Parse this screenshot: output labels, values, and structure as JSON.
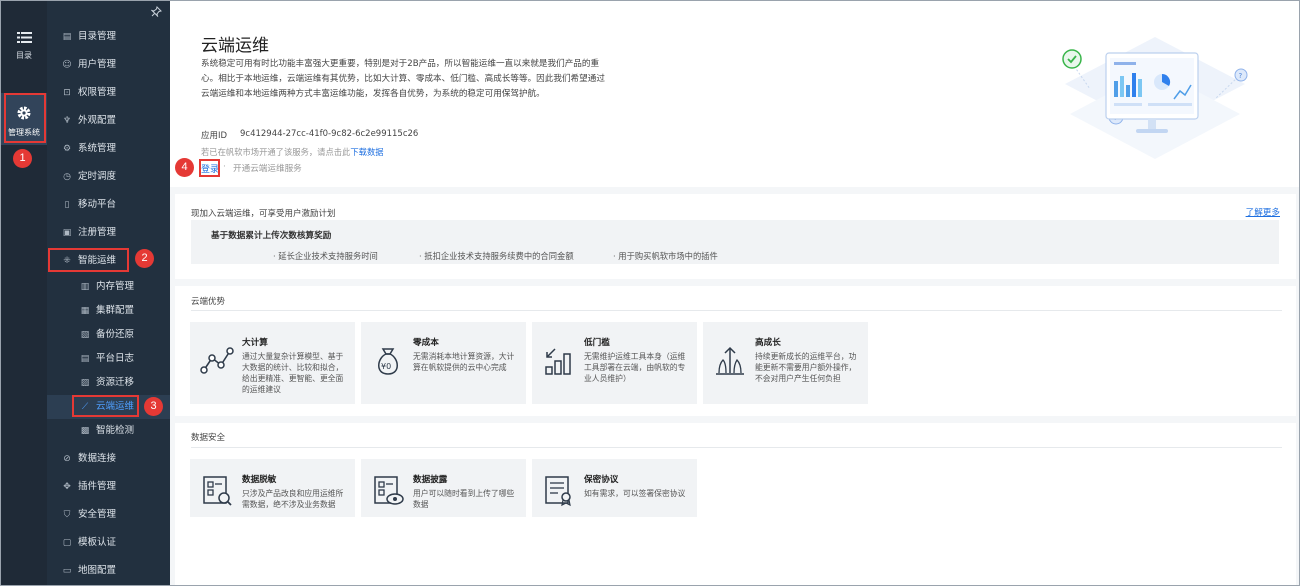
{
  "rail": {
    "items": [
      {
        "label": "目录",
        "icon": "list-icon"
      },
      {
        "label": "管理系统",
        "icon": "gear-icon"
      }
    ]
  },
  "nav": {
    "items": [
      {
        "label": "目录管理",
        "icon": "folder-icon"
      },
      {
        "label": "用户管理",
        "icon": "user-icon"
      },
      {
        "label": "权限管理",
        "icon": "lock-icon"
      },
      {
        "label": "外观配置",
        "icon": "paint-icon"
      },
      {
        "label": "系统管理",
        "icon": "settings-icon"
      },
      {
        "label": "定时调度",
        "icon": "clock-icon"
      },
      {
        "label": "移动平台",
        "icon": "mobile-icon"
      },
      {
        "label": "注册管理",
        "icon": "register-icon"
      },
      {
        "label": "智能运维",
        "icon": "nodes-icon"
      }
    ],
    "sub_items": [
      {
        "label": "内存管理",
        "icon": "memory-icon"
      },
      {
        "label": "集群配置",
        "icon": "cluster-icon"
      },
      {
        "label": "备份还原",
        "icon": "backup-icon"
      },
      {
        "label": "平台日志",
        "icon": "log-icon"
      },
      {
        "label": "资源迁移",
        "icon": "migrate-icon"
      },
      {
        "label": "云端运维",
        "icon": "chart-line-icon"
      },
      {
        "label": "智能检测",
        "icon": "detect-icon"
      }
    ],
    "bottom_items": [
      {
        "label": "数据连接",
        "icon": "link-icon"
      },
      {
        "label": "插件管理",
        "icon": "plugin-icon"
      },
      {
        "label": "安全管理",
        "icon": "shield-icon"
      },
      {
        "label": "模板认证",
        "icon": "certificate-icon"
      },
      {
        "label": "地图配置",
        "icon": "map-icon"
      }
    ]
  },
  "badges": [
    "1",
    "2",
    "3",
    "4"
  ],
  "hero": {
    "title": "云端运维",
    "description": "系统稳定可用有时比功能丰富强大更重要，特别是对于2B产品，所以智能运维一直以来就是我们产品的重心。相比于本地运维，云端运维有其优势，比如大计算、零成本、低门槛、高成长等等。因此我们希望通过云端运维和本地运维两种方式丰富运维功能，发挥各自优势，为系统的稳定可用保驾护航。",
    "app_id_label": "应用ID",
    "app_id": "9c412944-27cc-41f0-9c82-6c2e99115c26",
    "hint_prefix": "若已在帆软市场开通了该服务，请点击此",
    "hint_link": "下载数据",
    "login": "登录",
    "separator": "·",
    "open_service": "开通云端运维服务"
  },
  "incentive": {
    "title": "现加入云端运维，可享受用户激励计划",
    "learn_more": "了解更多",
    "bonus_title": "基于数据累计上传次数核算奖励",
    "bonus_items": [
      "· 延长企业技术支持服务时间",
      "· 抵扣企业技术支持服务续费中的合同金额",
      "· 用于购买帆软市场中的插件"
    ]
  },
  "advantages": {
    "title": "云端优势",
    "cards": [
      {
        "title": "大计算",
        "desc": "通过大量复杂计算模型、基于大数据的统计、比较和拟合，给出更精准、更智能、更全面的运维建议",
        "icon": "analytics-nodes-icon"
      },
      {
        "title": "零成本",
        "desc": "无需消耗本地计算资源，大计算在帆软提供的云中心完成",
        "icon": "money-bag-icon"
      },
      {
        "title": "低门槛",
        "desc": "无需维护运维工具本身（运维工具部署在云端，由帆软的专业人员维护）",
        "icon": "low-threshold-icon"
      },
      {
        "title": "高成长",
        "desc": "持续更新成长的运维平台，功能更新不需要用户额外操作，不会对用户产生任何负担",
        "icon": "growth-icon"
      }
    ]
  },
  "security": {
    "title": "数据安全",
    "cards": [
      {
        "title": "数据脱敏",
        "desc": "只涉及产品改良和应用运维所需数据，绝不涉及业务数据",
        "icon": "data-mask-icon"
      },
      {
        "title": "数据披露",
        "desc": "用户可以随时看到上传了哪些数据",
        "icon": "data-view-icon"
      },
      {
        "title": "保密协议",
        "desc": "如有需求，可以签署保密协议",
        "icon": "agreement-icon"
      }
    ]
  },
  "colors": {
    "accent": "#1e6fe0",
    "highlight": "#e53935",
    "rail_bg": "#1f2a37",
    "nav_bg": "#22303f"
  }
}
